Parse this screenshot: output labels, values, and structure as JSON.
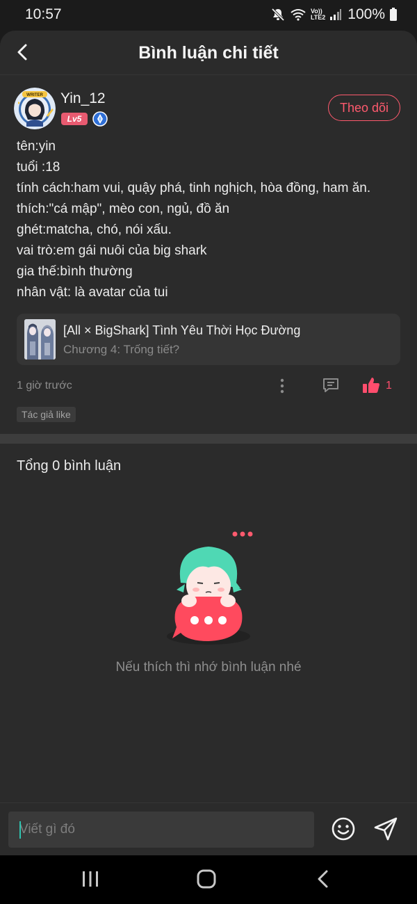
{
  "status_bar": {
    "time": "10:57",
    "network_label_top": "Vo))",
    "network_label_bottom": "LTE2",
    "battery": "100%"
  },
  "header": {
    "title": "Bình luận chi tiết",
    "back_icon": "chevron-left-icon"
  },
  "post": {
    "author": {
      "name": "Yin_12",
      "avatar_text": "WRITER",
      "level": "Lv5",
      "follow_label": "Theo dõi"
    },
    "lines": [
      "tên:yin",
      "tuổi :18",
      "tính cách:ham vui, quậy phá, tinh nghịch, hòa đồng, ham ăn.",
      "thích:\"cá mập\", mèo con, ngủ, đồ ăn",
      "ghét:matcha, chó, nói xấu.",
      "vai trò:em gái nuôi của big shark",
      "gia thế:bình thường",
      "nhân vật: là avatar của tui"
    ],
    "story": {
      "title": "[All × BigShark] Tình Yêu Thời Học Đường",
      "chapter": "Chương 4: Trống tiết?"
    },
    "time_ago": "1 giờ trước",
    "like_count": "1",
    "author_like_tag": "Tác giả like"
  },
  "comments": {
    "total_label": "Tổng 0 bình luận",
    "empty_message": "Nếu thích thì nhớ bình luận nhé"
  },
  "input": {
    "placeholder": "Viết gì đó"
  },
  "colors": {
    "accent": "#ff5a6e",
    "like": "#ff4d6d",
    "background": "#2b2b2b",
    "caret": "#2ec4b0"
  }
}
